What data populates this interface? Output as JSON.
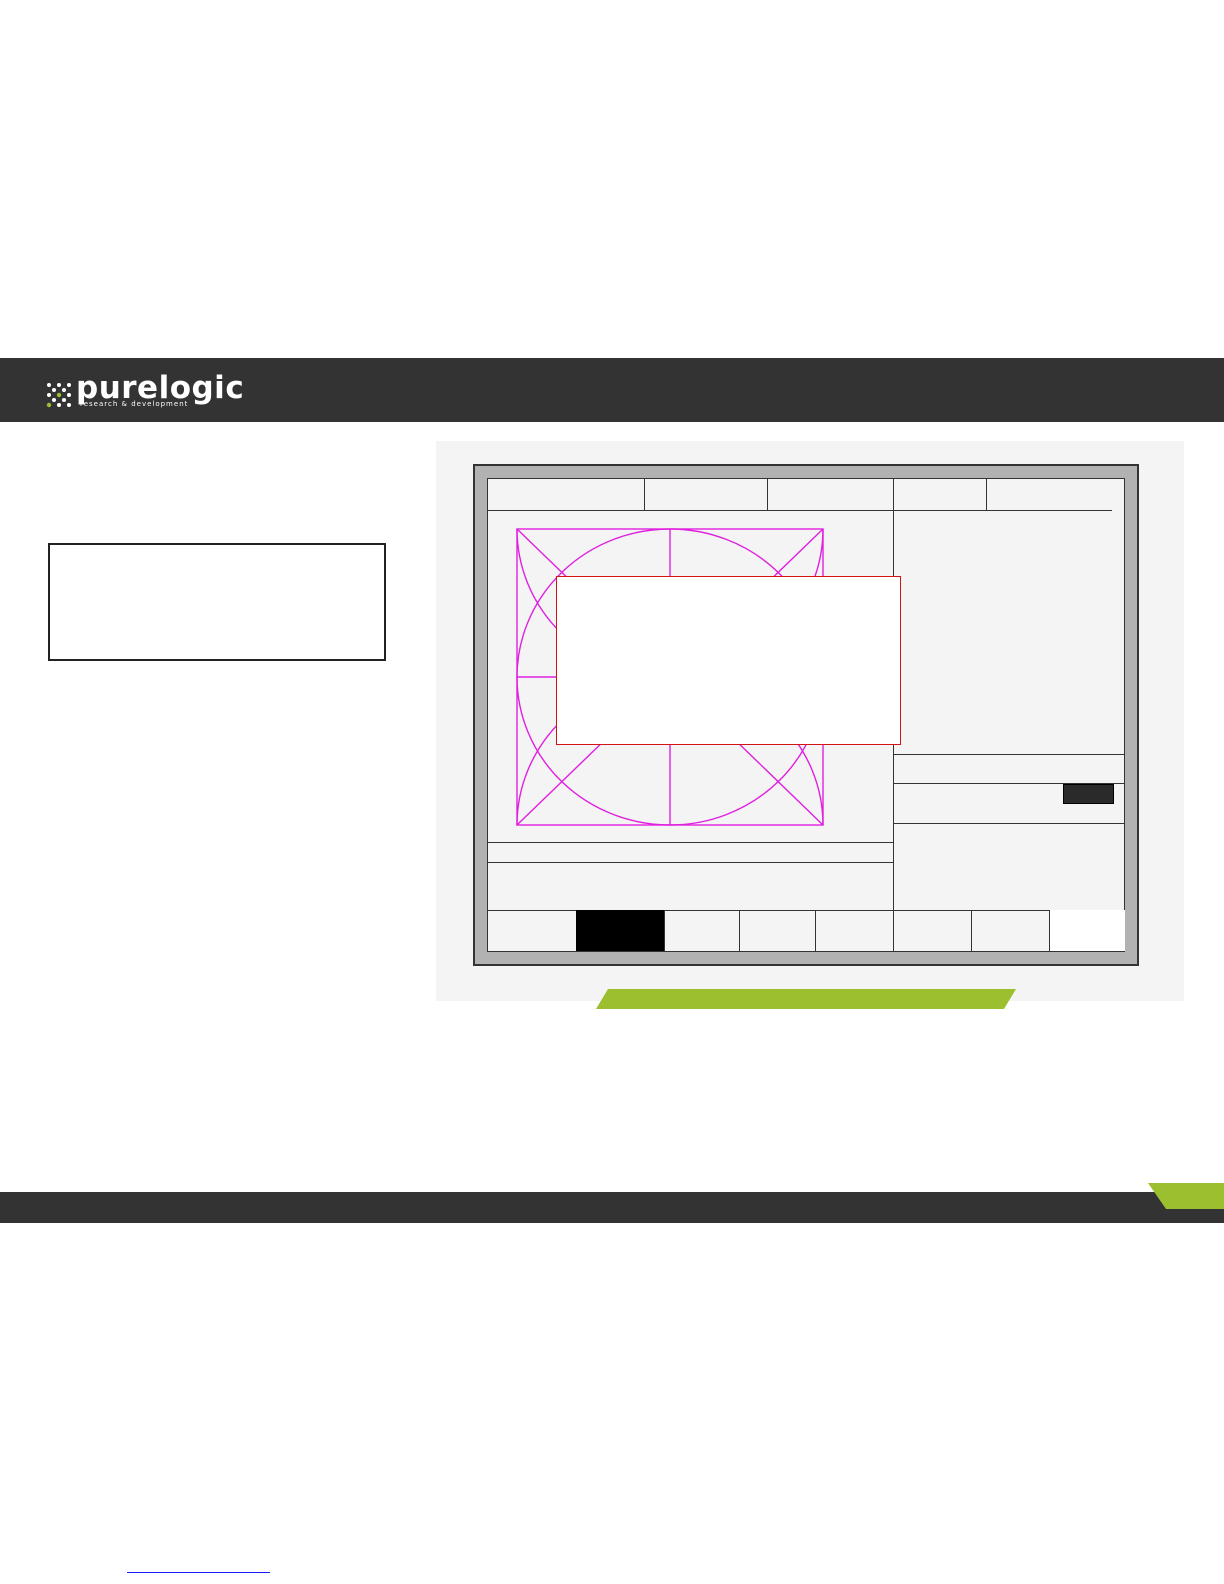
{
  "brand": {
    "logo_text": "purelogic",
    "logo_tagline": "research & development",
    "header_color": "#333333",
    "accent_color": "#9bbf2e"
  },
  "illustration": {
    "drawing_color": "#e020e0",
    "callout_border_color": "#d21414",
    "frame_color": "#b2b2b2"
  }
}
